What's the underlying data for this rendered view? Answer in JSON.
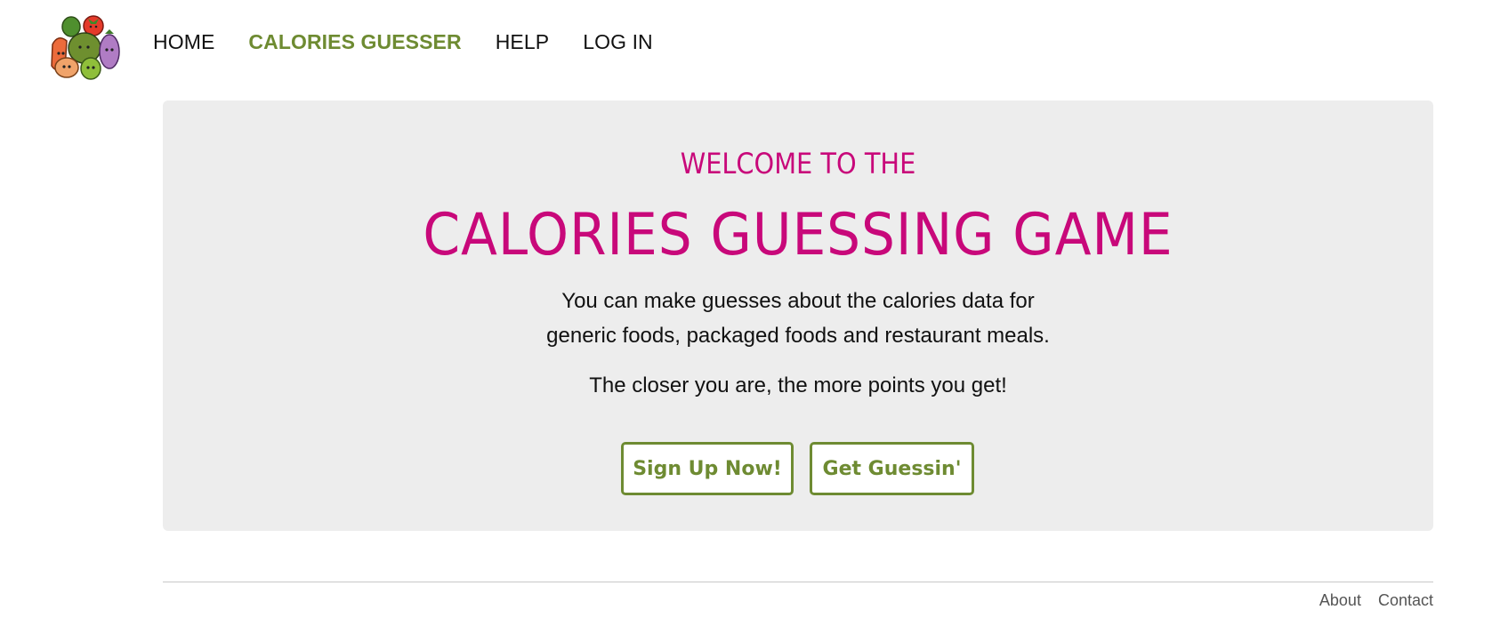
{
  "nav": {
    "items": [
      {
        "label": "HOME",
        "active": false
      },
      {
        "label": "CALORIES GUESSER",
        "active": true
      },
      {
        "label": "HELP",
        "active": false
      },
      {
        "label": "LOG IN",
        "active": false
      }
    ]
  },
  "hero": {
    "welcome": "WELCOME TO THE",
    "title": "CALORIES GUESSING GAME",
    "description_line1": "You can make guesses about the calories data for",
    "description_line2": "generic foods, packaged foods and restaurant meals.",
    "tagline": "The closer you are, the more points you get!",
    "signup_label": "Sign Up Now!",
    "guess_label": "Get Guessin'"
  },
  "footer": {
    "about_label": "About",
    "contact_label": "Contact"
  },
  "colors": {
    "accent_green": "#6e8b32",
    "title_magenta": "#c8087a",
    "hero_bg": "#ededed"
  },
  "logo": {
    "icon": "vegetables-logo-icon"
  }
}
